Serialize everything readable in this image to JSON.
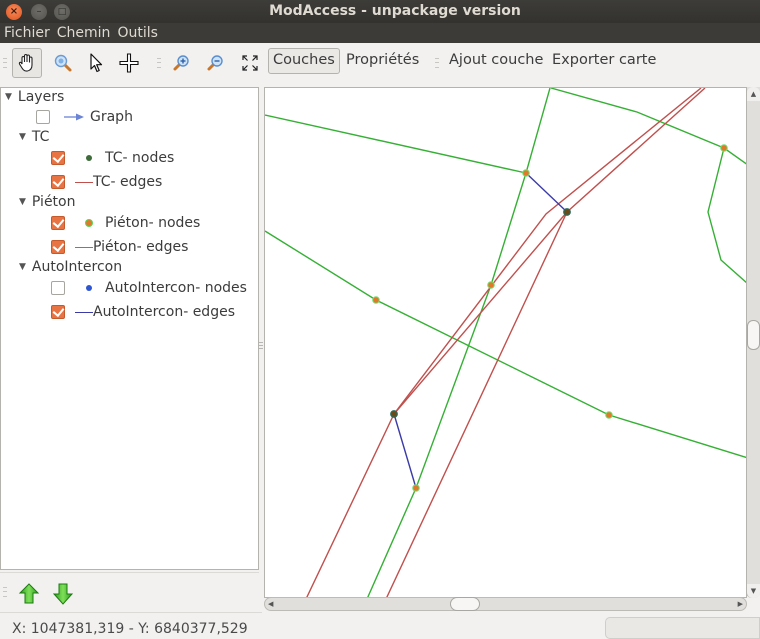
{
  "window": {
    "title": "ModAccess - unpackage version",
    "controls": {
      "close": "×",
      "minimize": "–",
      "maximize": "□"
    }
  },
  "menubar": {
    "items": [
      {
        "label": "Fichier"
      },
      {
        "label": "Chemin"
      },
      {
        "label": "Outils"
      }
    ]
  },
  "toolbar": {
    "tools": [
      {
        "icon": "hand-pan-icon",
        "active": true
      },
      {
        "icon": "zoom-area-icon",
        "active": false
      },
      {
        "icon": "select-pointer-icon",
        "active": false
      },
      {
        "icon": "crosshair-add-icon",
        "active": false
      },
      {
        "icon": "zoom-in-icon",
        "active": false
      },
      {
        "icon": "zoom-out-icon",
        "active": false
      },
      {
        "icon": "zoom-full-extent-icon",
        "active": false
      }
    ],
    "couches_label": "Couches",
    "proprietes_label": "Propriétés",
    "ajout_couche_label": "Ajout couche",
    "exporter_carte_label": "Exporter carte"
  },
  "layers": {
    "root_label": "Layers",
    "graph": {
      "label": "Graph",
      "checked": false,
      "symbol_color": "#6b84d6"
    },
    "groups": [
      {
        "label": "TC",
        "items": [
          {
            "label": "TC- nodes",
            "checked": true,
            "symbol": "dot",
            "color": "#3d6b3a"
          },
          {
            "label": "TC- edges",
            "checked": true,
            "symbol": "line",
            "color": "#c0504d"
          }
        ]
      },
      {
        "label": "Piéton",
        "items": [
          {
            "label": "Piéton- nodes",
            "checked": true,
            "symbol": "dot",
            "color": "#e07a2a",
            "outline": "#5ad35a"
          },
          {
            "label": "Piéton- edges",
            "checked": true,
            "symbol": "line",
            "color": "#2cb22c"
          }
        ]
      },
      {
        "label": "AutoIntercon",
        "items": [
          {
            "label": "AutoIntercon- nodes",
            "checked": false,
            "symbol": "dot",
            "color": "#2f56d0"
          },
          {
            "label": "AutoIntercon- edges",
            "checked": true,
            "symbol": "line",
            "color": "#3b3ba8"
          }
        ]
      }
    ]
  },
  "layer_order_buttons": {
    "up": "move-layer-up",
    "down": "move-layer-down"
  },
  "map": {
    "colors": {
      "pieton_edge": "#35b035",
      "tc_edge": "#c0504d",
      "intercon_edge": "#3b3ba8",
      "pieton_node": "#e07a2a",
      "pieton_node_outline": "#70e070",
      "tc_node": "#6b4a1a",
      "tc_node_outline": "#2a6a5a"
    }
  },
  "status": {
    "coordinates": "X: 1047381,319 - Y: 6840377,529"
  }
}
